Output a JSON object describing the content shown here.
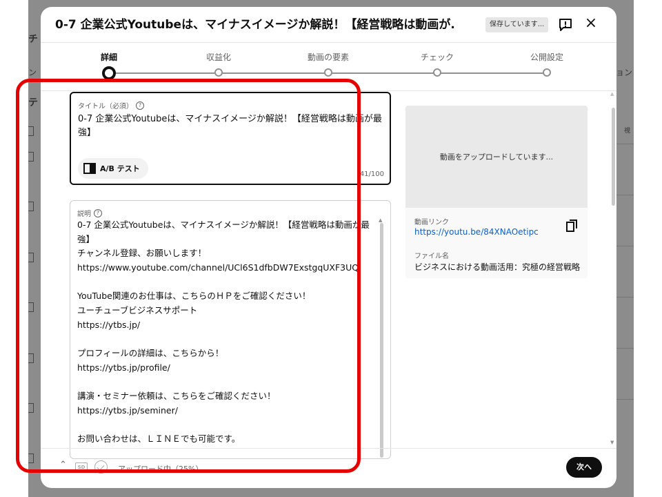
{
  "background": {
    "fragments": [
      "チ",
      "ン",
      "テ",
      "ョン",
      "視"
    ]
  },
  "dialog": {
    "title": "0-7 企業公式Youtubeは、マイナスイメージか解説！【経営戦略は動画が...",
    "saving_badge": "保存しています...",
    "feedback_icon": "feedback-icon",
    "close_icon": "×"
  },
  "stepper": {
    "steps": [
      {
        "label": "詳細",
        "active": true
      },
      {
        "label": "収益化",
        "active": false
      },
      {
        "label": "動画の要素",
        "active": false
      },
      {
        "label": "チェック",
        "active": false
      },
      {
        "label": "公開設定",
        "active": false
      }
    ]
  },
  "title_field": {
    "label": "タイトル（必須）",
    "value": "0-7 企業公式Youtubeは、マイナスイメージか解説！【経営戦略は動画が最強】",
    "ab_test_label": "A/B テスト",
    "counter": "41/100"
  },
  "description_field": {
    "label": "説明",
    "lines": [
      "0-7 企業公式Youtubeは、マイナスイメージか解説！【経営戦略は動画が最",
      "強】",
      "チャンネル登録、お願いします！",
      "https://www.youtube.com/channel/UCl6S1dfbDW7ExstgqUXF3UQ",
      "",
      "YouTube関連のお仕事は、こちらのＨＰをご確認ください！",
      "ユーチューブビジネスサポート",
      "https://ytbs.jp/",
      "",
      "プロフィールの詳細は、こちらから！",
      "https://ytbs.jp/profile/",
      "",
      "講演・セミナー依頼は、こちらをご確認ください！",
      "https://ytbs.jp/seminer/",
      "",
      "お問い合わせは、ＬＩＮＥでも可能です。"
    ]
  },
  "preview": {
    "uploading_message": "動画をアップロードしています...",
    "video_link_label": "動画リンク",
    "video_link": "https://youtu.be/84XNAOetipc",
    "file_name_label": "ファイル名",
    "file_name": "ビジネスにおける動画活用：究極の経営戦略"
  },
  "footer": {
    "sd_badge": "SD",
    "upload_status": "アップロード中（25%）...",
    "upload_progress_percent": 25,
    "next_label": "次へ"
  },
  "annotation": {
    "highlight_color": "#e60000"
  }
}
